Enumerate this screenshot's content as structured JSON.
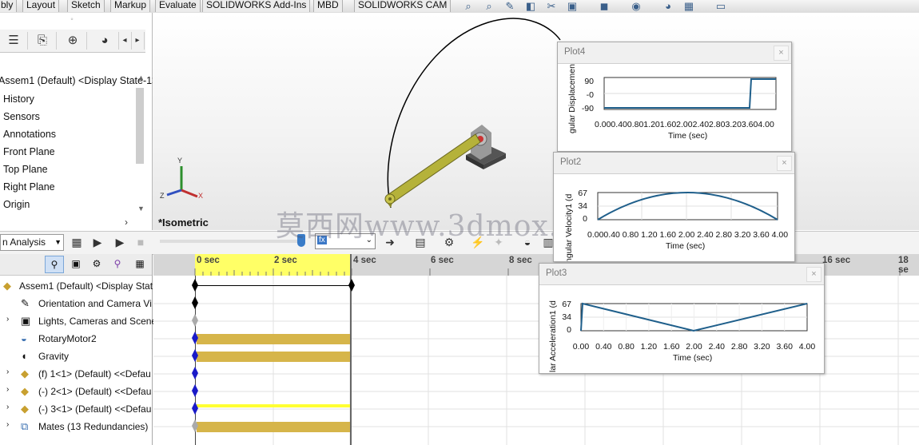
{
  "tabs": [
    "bly",
    "Layout",
    "Sketch",
    "Markup",
    "Evaluate",
    "SOLIDWORKS Add-Ins",
    "MBD",
    "SOLIDWORKS CAM"
  ],
  "feature_tree": {
    "root": "Assem1 (Default) <Display State-1>",
    "items": [
      "History",
      "Sensors",
      "Annotations",
      "Front Plane",
      "Top Plane",
      "Right Plane",
      "Origin"
    ]
  },
  "view_label": "*Isometric",
  "axes_triad": {
    "x": "X",
    "y": "Y",
    "z": "Z"
  },
  "motion_toolbar": {
    "study_type": "n Analysis",
    "fx_value": "fx"
  },
  "motion_tree": {
    "items": [
      "Assem1 (Default) <Display Stat",
      "Orientation and Camera Vi",
      "Lights, Cameras and Scene",
      "RotaryMotor2",
      "Gravity",
      "(f) 1<1> (Default) <<Defau",
      "(-) 2<1> (Default) <<Defau",
      "(-) 3<1> (Default) <<Defau",
      "Mates (13 Redundancies)"
    ]
  },
  "timeline": {
    "ticks": [
      "0 sec",
      "2 sec",
      "4 sec",
      "6 sec",
      "8 sec",
      "16 sec",
      "18 se"
    ]
  },
  "plots": [
    {
      "title": "Plot4",
      "ylabel": "gular Displacemen",
      "xlabel": "Time (sec)",
      "yticks": [
        "90",
        "-0",
        "-90"
      ],
      "xticklabel": "0.000.400.801.201.602.002.402.803.203.604.00",
      "color": "#1f5f8b"
    },
    {
      "title": "Plot2",
      "ylabel": "ngular Velocity1 (d",
      "xlabel": "Time (sec)",
      "yticks": [
        "67",
        "34",
        "0"
      ],
      "xticklabel": "0.000.40 0.80 1.20 1.60 2.00 2.40 2.80 3.20 3.60 4.00",
      "color": "#1f5f8b"
    },
    {
      "title": "Plot3",
      "ylabel": "lar Acceleration1 (d",
      "xlabel": "Time (sec)",
      "yticks": [
        "67",
        "34",
        "0"
      ],
      "xticks": [
        "0.00",
        "0.40",
        "0.80",
        "1.20",
        "1.60",
        "2.00",
        "2.40",
        "2.80",
        "3.20",
        "3.60",
        "4.00"
      ],
      "color": "#1f5f8b"
    }
  ],
  "watermark": "莫西网www.3dmox.com"
}
